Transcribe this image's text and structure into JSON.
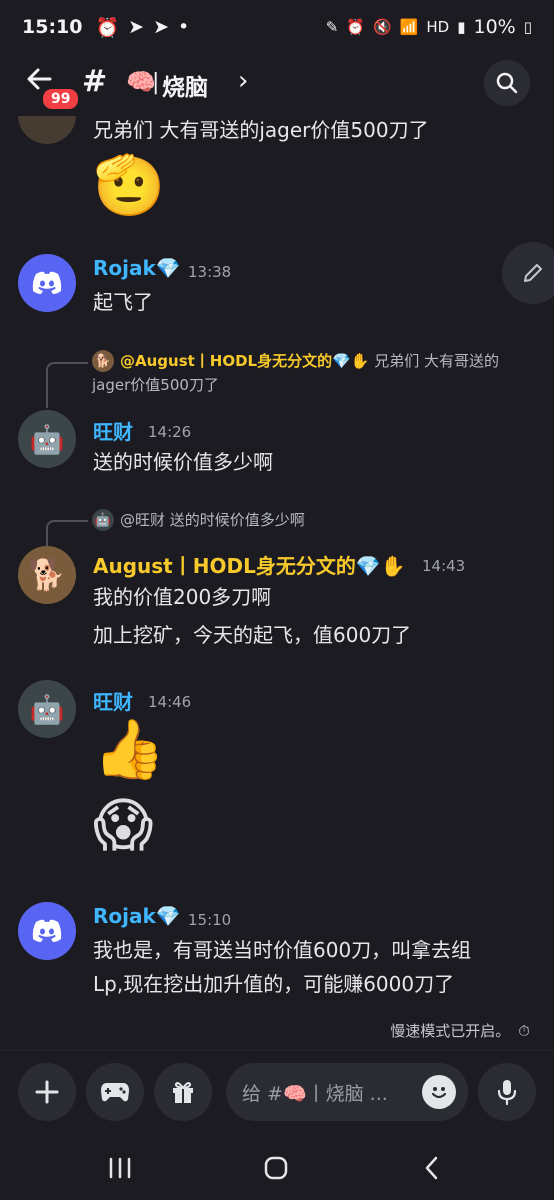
{
  "status_bar": {
    "time": "15:10",
    "battery": "10%",
    "network": "HD"
  },
  "header": {
    "badge": "99",
    "channel_emoji": "🧠",
    "channel_name": "烧脑"
  },
  "messages": {
    "partial_text": "兄弟们 大有哥送的jager价值500刀了",
    "partial_emoji": "🫡",
    "m1": {
      "user": "Rojak💎",
      "time": "13:38",
      "text": "起飞了"
    },
    "m2": {
      "reply_name": "@August丨HODL身无分文的💎✋",
      "reply_text_1": " 兄弟们 大有哥送的",
      "reply_text_2": "jager价值500刀了",
      "user": "旺财",
      "time": "14:26",
      "text": "送的时候价值多少啊"
    },
    "m3": {
      "reply_name": "@旺财",
      "reply_text": " 送的时候价值多少啊",
      "user": "August丨HODL身无分文的💎✋",
      "time": "14:43",
      "text_1": "我的价值200多刀啊",
      "text_2": "加上挖矿，今天的起飞，值600刀了"
    },
    "m4": {
      "user": "旺财",
      "time": "14:46",
      "emoji_1": "👍",
      "emoji_2": "😱"
    },
    "m5": {
      "user": "Rojak💎",
      "time": "15:10",
      "text_1": "我也是，有哥送当时价值600刀，叫拿去组",
      "text_2": "Lp,现在挖出加升值的，可能赚6000刀了"
    }
  },
  "slow_mode": "慢速模式已开启。",
  "input": {
    "placeholder": "给 #🧠丨烧脑 ..."
  }
}
